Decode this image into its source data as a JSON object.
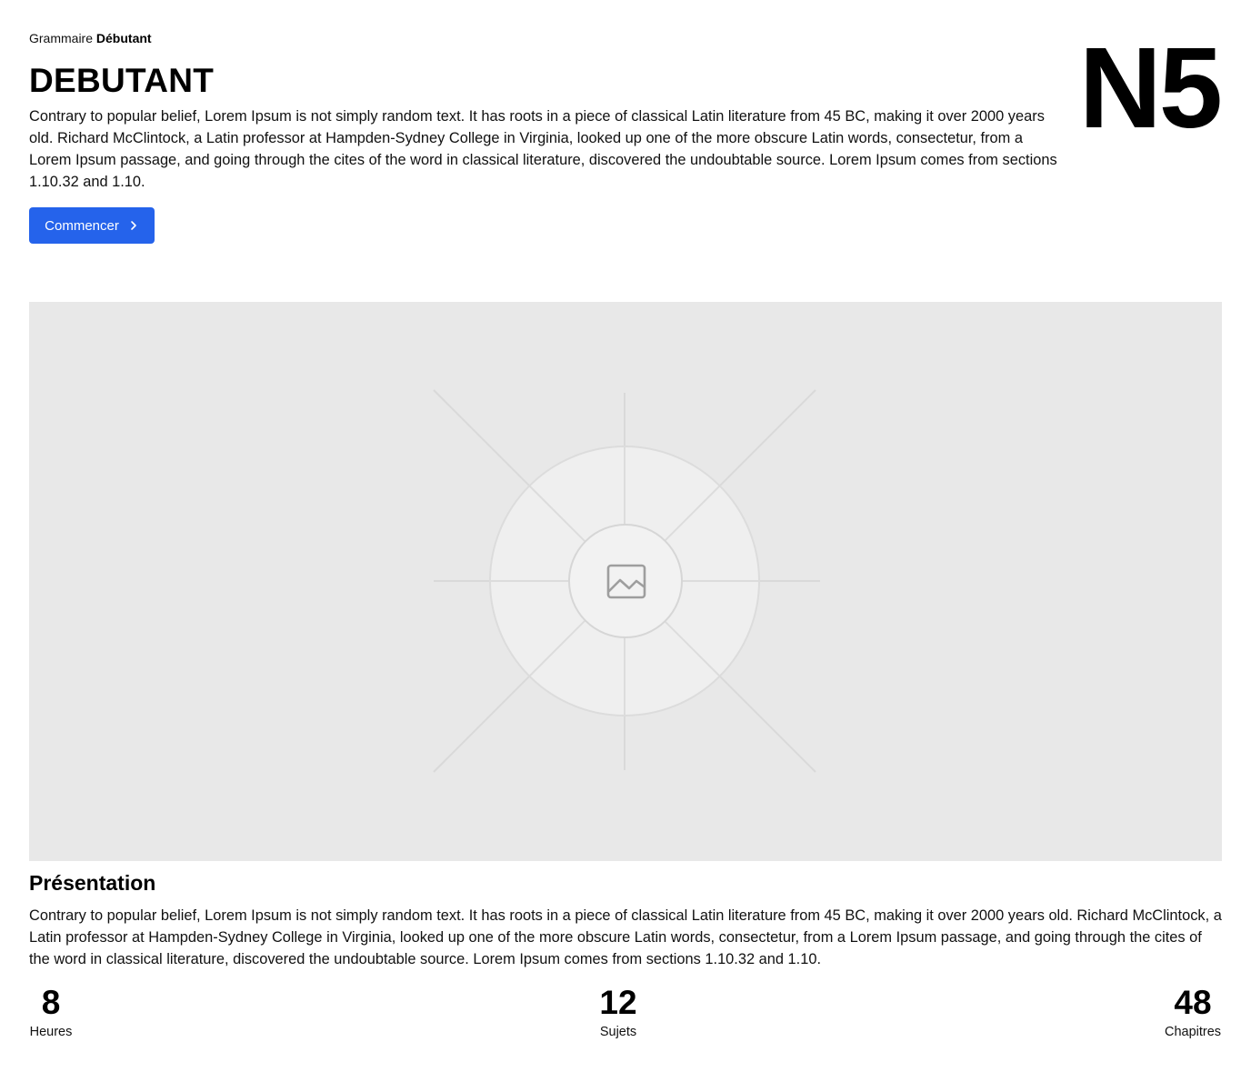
{
  "header": {
    "breadcrumb_prefix": "Grammaire",
    "breadcrumb_current": "Débutant",
    "title": "DEBUTANT",
    "level_badge": "N5",
    "description": "Contrary to popular belief, Lorem Ipsum is not simply random text. It has roots in a piece of classical Latin literature from 45 BC, making it over 2000 years old. Richard McClintock, a Latin professor at Hampden-Sydney College in Virginia, looked up one of the more obscure Latin words, consectetur, from a Lorem Ipsum passage, and going through the cites of the word in classical literature, discovered the undoubtable source. Lorem Ipsum comes from sections 1.10.32 and 1.10.",
    "cta_label": "Commencer",
    "cta_icon": "chevron-right-icon"
  },
  "media": {
    "icon": "image-placeholder-icon"
  },
  "presentation": {
    "title": "Présentation",
    "description": "Contrary to popular belief, Lorem Ipsum is not simply random text. It has roots in a piece of classical Latin literature from 45 BC, making it over 2000 years old. Richard McClintock, a Latin professor at Hampden-Sydney College in Virginia, looked up one of the more obscure Latin words, consectetur, from a Lorem Ipsum passage, and going through the cites of the word in classical literature, discovered the undoubtable source. Lorem Ipsum comes from sections 1.10.32 and 1.10."
  },
  "stats": [
    {
      "value": "8",
      "label": "Heures"
    },
    {
      "value": "12",
      "label": "Sujets"
    },
    {
      "value": "48",
      "label": "Chapitres"
    }
  ],
  "colors": {
    "accent": "#2563eb",
    "placeholder_bg": "#e8e8e8"
  }
}
